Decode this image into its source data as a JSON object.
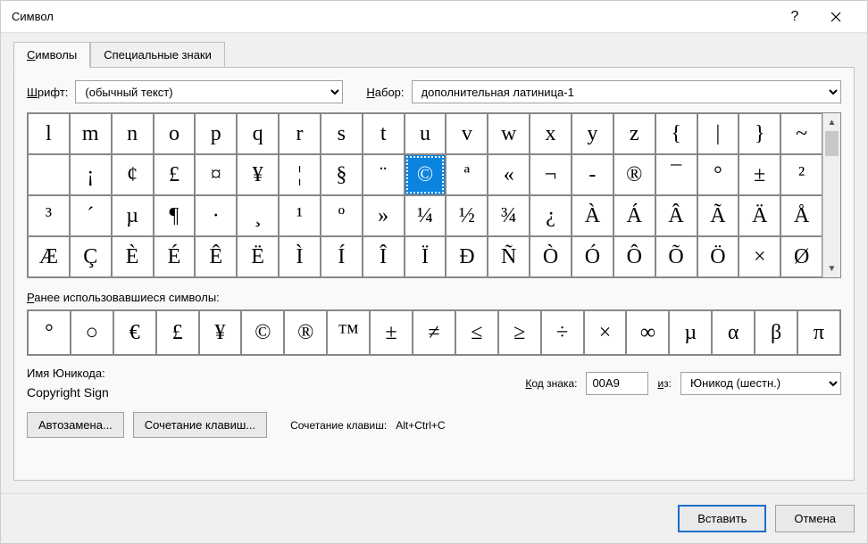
{
  "title": "Символ",
  "tabs": {
    "symbols": "Символы",
    "special": "Специальные знаки"
  },
  "font": {
    "label": "Шрифт:",
    "value": "(обычный текст)"
  },
  "subset": {
    "label": "Набор:",
    "value": "дополнительная латиница-1"
  },
  "grid": {
    "rows": [
      [
        "l",
        "m",
        "n",
        "o",
        "p",
        "q",
        "r",
        "s",
        "t",
        "u",
        "v",
        "w",
        "x",
        "y",
        "z",
        "{",
        "|",
        "}",
        "~"
      ],
      [
        "",
        "¡",
        "¢",
        "£",
        "¤",
        "¥",
        "¦",
        "§",
        "¨",
        "©",
        "ª",
        "«",
        "¬",
        "-",
        "®",
        "¯",
        "°",
        "±",
        "²"
      ],
      [
        "³",
        "´",
        "µ",
        "¶",
        "·",
        "¸",
        "¹",
        "º",
        "»",
        "¼",
        "½",
        "¾",
        "¿",
        "À",
        "Á",
        "Â",
        "Ã",
        "Ä",
        "Å"
      ],
      [
        "Æ",
        "Ç",
        "È",
        "É",
        "Ê",
        "Ë",
        "Ì",
        "Í",
        "Î",
        "Ï",
        "Ð",
        "Ñ",
        "Ò",
        "Ó",
        "Ô",
        "Õ",
        "Ö",
        "×",
        "Ø"
      ]
    ],
    "selected": {
      "row": 1,
      "col": 9
    }
  },
  "recent": {
    "label": "Ранее использовавшиеся символы:",
    "items": [
      "°",
      "○",
      "€",
      "£",
      "¥",
      "©",
      "®",
      "™",
      "±",
      "≠",
      "≤",
      "≥",
      "÷",
      "×",
      "∞",
      "µ",
      "α",
      "β",
      "π"
    ]
  },
  "unicode": {
    "label": "Имя Юникода:",
    "name": "Copyright Sign"
  },
  "code": {
    "label": "Код знака:",
    "value": "00A9"
  },
  "from": {
    "label": "из:",
    "value": "Юникод (шестн.)"
  },
  "autocorrect": "Автозамена...",
  "shortcutkey": "Сочетание клавиш...",
  "shortcut": {
    "label": "Сочетание клавиш:",
    "value": "Alt+Ctrl+C"
  },
  "insert": "Вставить",
  "cancel": "Отмена"
}
